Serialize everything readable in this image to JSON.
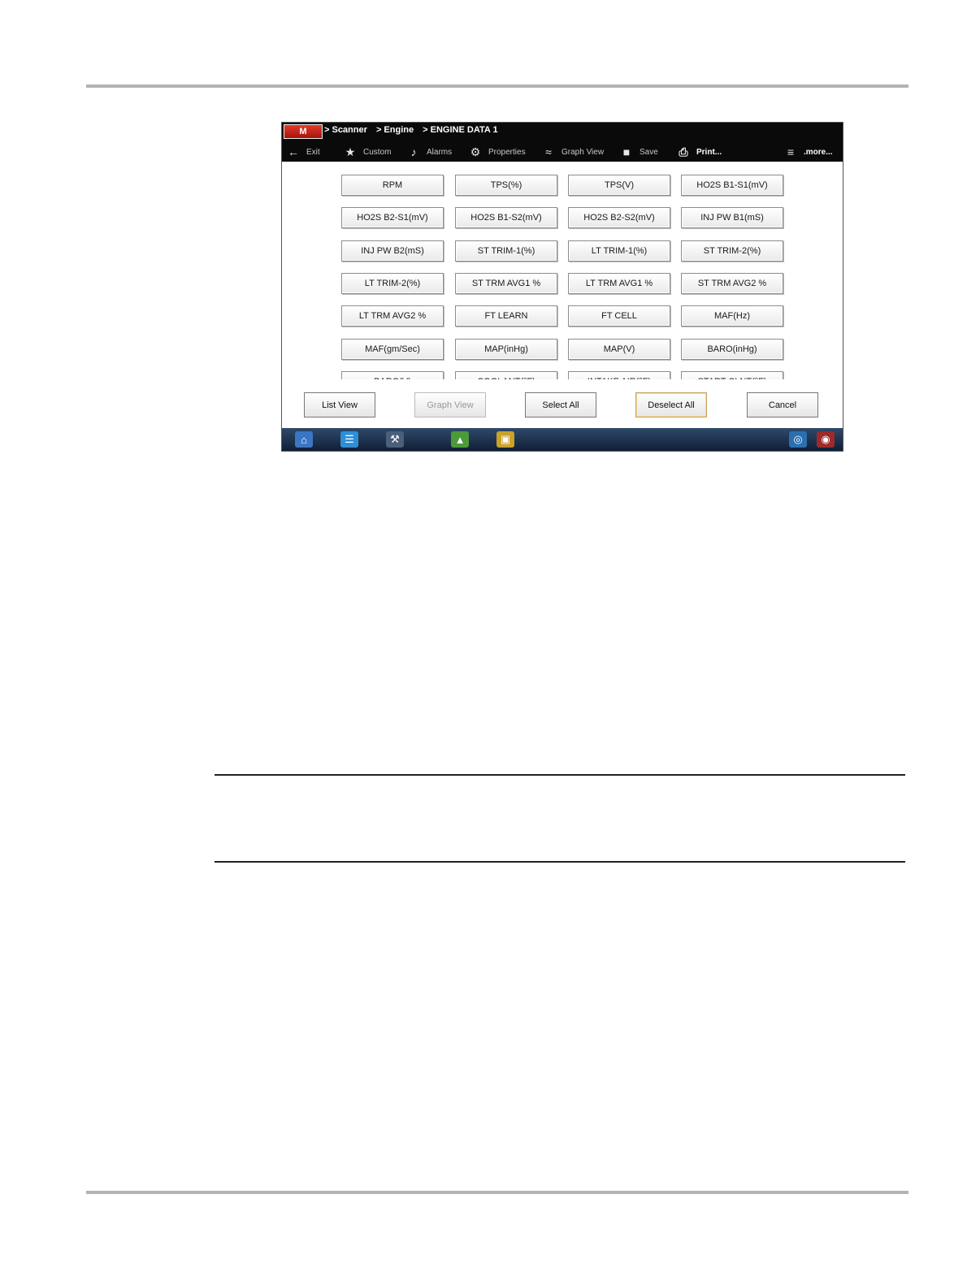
{
  "breadcrumb": [
    "> Scanner",
    "> Engine",
    "> ENGINE DATA 1"
  ],
  "logo_text": "M",
  "toolbar": [
    {
      "label": "Exit",
      "icon": "back-arrow-icon",
      "glyph": "←"
    },
    {
      "label": "Custom",
      "icon": "star-icon",
      "glyph": "★"
    },
    {
      "label": "Alarms",
      "icon": "bell-icon",
      "glyph": "♪"
    },
    {
      "label": "Properties",
      "icon": "gears-icon",
      "glyph": "⚙"
    },
    {
      "label": "Graph View",
      "icon": "graph-icon",
      "glyph": "≈"
    },
    {
      "label": "Save",
      "icon": "save-icon",
      "glyph": "■"
    },
    {
      "label": "Print...",
      "icon": "printer-icon",
      "glyph": "⎙"
    },
    {
      "label": ".more...",
      "icon": "menu-icon",
      "glyph": "≡"
    }
  ],
  "pid_buttons": [
    "RPM",
    "TPS(%)",
    "TPS(V)",
    "HO2S B1-S1(mV)",
    "HO2S B2-S1(mV)",
    "HO2S B1-S2(mV)",
    "HO2S B2-S2(mV)",
    "INJ PW B1(mS)",
    "INJ PW B2(mS)",
    "ST TRIM-1(%)",
    "LT TRIM-1(%)",
    "ST TRIM-2(%)",
    "LT TRIM-2(%)",
    "ST TRM AVG1 %",
    "LT TRM AVG1 %",
    "ST TRM AVG2 %",
    "LT TRM AVG2 %",
    "FT LEARN",
    "FT CELL",
    "MAF(Hz)",
    "MAF(gm/Sec)",
    "MAP(inHg)",
    "MAP(V)",
    "BARO(inHg)",
    "BARO(V)",
    "COOLANT(°F)",
    "INTAKE AIR(°F)",
    "START CLNT(°F)"
  ],
  "actions": {
    "list_view": "List View",
    "graph_view": "Graph View",
    "select_all": "Select All",
    "deselect_all": "Deselect All",
    "cancel": "Cancel"
  },
  "taskbar_icons": [
    "home-icon",
    "data-list-icon",
    "tools-icon",
    "vehicle-icon",
    "image-icon",
    "wireless-icon",
    "camera-icon"
  ]
}
